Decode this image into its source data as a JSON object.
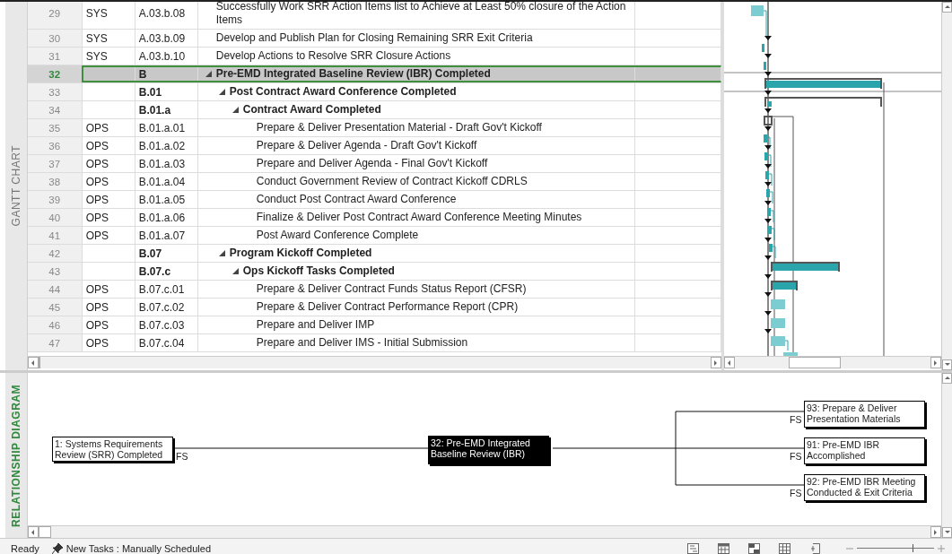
{
  "gantt_view": {
    "tab_label": "GANTT CHART",
    "rows": [
      {
        "num": "29",
        "team": "SYS",
        "wbs": "A.03.b.08",
        "name": "Successfully Work SRR Action Items list to Achieve at Least 50% closure of the Action Items",
        "kind": "task",
        "selected": false
      },
      {
        "num": "30",
        "team": "SYS",
        "wbs": "A.03.b.09",
        "name": "Develop and Publish Plan for Closing Remaining SRR Exit Criteria",
        "kind": "task",
        "selected": false
      },
      {
        "num": "31",
        "team": "SYS",
        "wbs": "A.03.b.10",
        "name": "Develop Actions to Resolve SRR Closure Actions",
        "kind": "task",
        "selected": false
      },
      {
        "num": "32",
        "wbs": "B",
        "name": "Pre-EMD Integrated Baseline Review (IBR) Completed",
        "kind": "summary",
        "expanded": true,
        "selected": true,
        "children": [
          {
            "num": "33",
            "wbs": "B.01",
            "name": "Post Contract Award Conference Completed",
            "kind": "summary",
            "expanded": true,
            "selected": false,
            "children": [
              {
                "num": "34",
                "wbs": "B.01.a",
                "name": "Contract Award Completed",
                "kind": "summary",
                "expanded": true,
                "selected": false,
                "children": [
                  {
                    "num": "35",
                    "team": "OPS",
                    "wbs": "B.01.a.01",
                    "name": "Prepare & Deliver Presentation Material - Draft Gov't Kickoff",
                    "kind": "task",
                    "selected": false
                  },
                  {
                    "num": "36",
                    "team": "OPS",
                    "wbs": "B.01.a.02",
                    "name": "Prepare & Deliver Agenda - Draft Gov't Kickoff",
                    "kind": "task",
                    "selected": false
                  },
                  {
                    "num": "37",
                    "team": "OPS",
                    "wbs": "B.01.a.03",
                    "name": "Prepare and Deliver Agenda - Final Gov't Kickoff",
                    "kind": "task",
                    "selected": false
                  },
                  {
                    "num": "38",
                    "team": "OPS",
                    "wbs": "B.01.a.04",
                    "name": "Conduct Government Review of Contract Kickoff CDRLS",
                    "kind": "task",
                    "selected": false
                  },
                  {
                    "num": "39",
                    "team": "OPS",
                    "wbs": "B.01.a.05",
                    "name": "Conduct Post Contract Award Conference",
                    "kind": "task",
                    "selected": false
                  },
                  {
                    "num": "40",
                    "team": "OPS",
                    "wbs": "B.01.a.06",
                    "name": "Finalize & Deliver Post Contract Award Conference Meeting Minutes",
                    "kind": "task",
                    "selected": false
                  },
                  {
                    "num": "41",
                    "team": "OPS",
                    "wbs": "B.01.a.07",
                    "name": "Post Award Conference Complete",
                    "kind": "task",
                    "selected": false
                  }
                ]
              }
            ]
          },
          {
            "num": "42",
            "wbs": "B.07",
            "name": "Program Kickoff Completed",
            "kind": "summary",
            "expanded": true,
            "selected": false,
            "children": [
              {
                "num": "43",
                "wbs": "B.07.c",
                "name": "Ops Kickoff Tasks Completed",
                "kind": "summary",
                "expanded": true,
                "selected": false,
                "children": [
                  {
                    "num": "44",
                    "team": "OPS",
                    "wbs": "B.07.c.01",
                    "name": "Prepare & Deliver Contract Funds Status Report (CFSR)",
                    "kind": "task",
                    "selected": false
                  },
                  {
                    "num": "45",
                    "team": "OPS",
                    "wbs": "B.07.c.02",
                    "name": "Prepare & Deliver Contract Performance Report (CPR)",
                    "kind": "task",
                    "selected": false
                  },
                  {
                    "num": "46",
                    "team": "OPS",
                    "wbs": "B.07.c.03",
                    "name": "Prepare and Deliver IMP",
                    "kind": "task",
                    "selected": false
                  },
                  {
                    "num": "47",
                    "team": "OPS",
                    "wbs": "B.07.c.04",
                    "name": "Prepare and Deliver IMS - Initial Submission",
                    "kind": "task",
                    "selected": false
                  }
                ]
              }
            ]
          }
        ]
      }
    ]
  },
  "relationship_diagram": {
    "tab_label": "RELATIONSHIP DIAGRAM",
    "predecessors": [
      {
        "label": "1: Systems Requirements Review (SRR) Completed",
        "link_type": "FS",
        "selected": false
      }
    ],
    "current": {
      "label": "32: Pre-EMD Integrated Baseline Review (IBR)",
      "selected": true
    },
    "successors": [
      {
        "label": "93: Prepare & Deliver Presentation Materials",
        "link_type": "FS",
        "selected": false
      },
      {
        "label": "91: Pre-EMD IBR Accomplished",
        "link_type": "FS",
        "selected": false
      },
      {
        "label": "92: Pre-EMD IBR Meeting Conducted & Exit Criteria",
        "link_type": "FS",
        "selected": false
      }
    ]
  },
  "status_bar": {
    "status": "Ready",
    "task_mode": "New Tasks : Manually Scheduled",
    "zoom": {
      "level": 0.72
    }
  }
}
